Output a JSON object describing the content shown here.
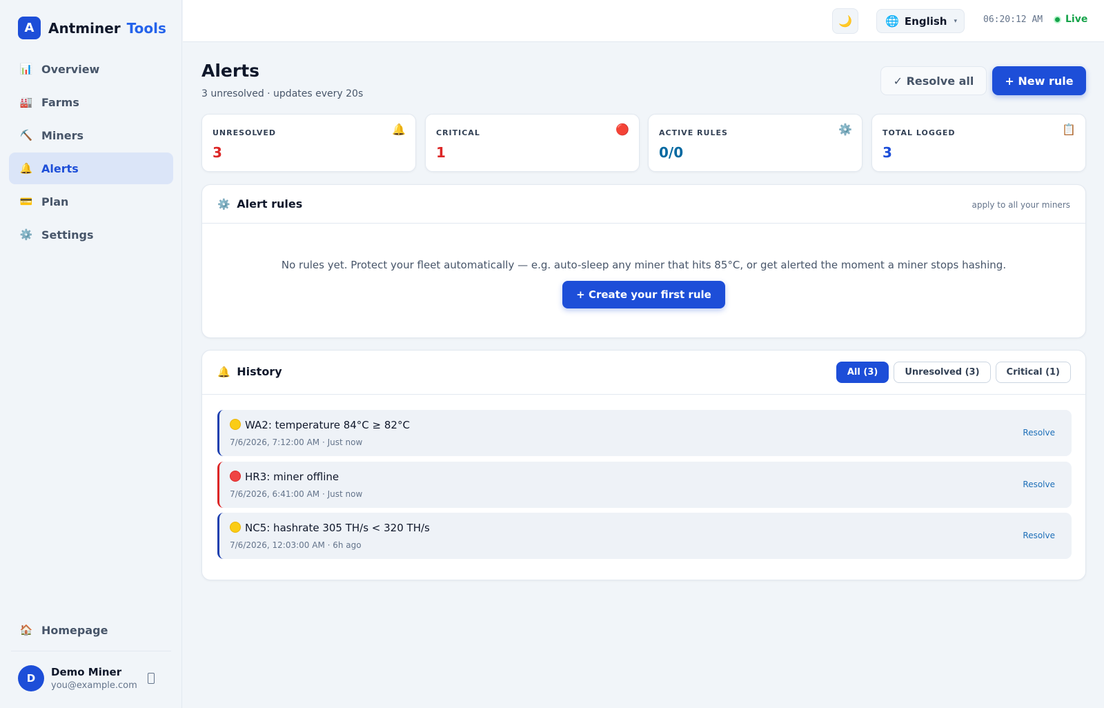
{
  "brand": {
    "badge": "A",
    "name": "Antminer",
    "accent": "Tools"
  },
  "sidebar": {
    "items": [
      {
        "icon": "📊",
        "label": "Overview"
      },
      {
        "icon": "🏭",
        "label": "Farms"
      },
      {
        "icon": "⛏️",
        "label": "Miners"
      },
      {
        "icon": "🔔",
        "label": "Alerts",
        "active": true
      },
      {
        "icon": "💳",
        "label": "Plan"
      },
      {
        "icon": "⚙️",
        "label": "Settings"
      }
    ],
    "homepage": {
      "icon": "🏠",
      "label": "Homepage"
    },
    "user": {
      "initial": "D",
      "name": "Demo Miner",
      "email": "you@example.com"
    }
  },
  "topbar": {
    "theme_icon": "🌙",
    "language": {
      "icon": "🌐",
      "label": "English",
      "caret": "▾"
    },
    "time": "06:20:12 AM",
    "status": "Live"
  },
  "page": {
    "title": "Alerts",
    "subtitle": "3 unresolved · updates every 20s",
    "resolve_all": "✓ Resolve all",
    "new_rule": "+ New rule"
  },
  "stats": [
    {
      "label": "UNRESOLVED",
      "value": "3",
      "icon": "🔔",
      "color": "#dc2626"
    },
    {
      "label": "CRITICAL",
      "value": "1",
      "icon": "🔴",
      "color": "#dc2626"
    },
    {
      "label": "ACTIVE RULES",
      "value": "0/0",
      "icon": "⚙️",
      "color": "#0369a1"
    },
    {
      "label": "TOTAL LOGGED",
      "value": "3",
      "icon": "📋",
      "color": "#1d4ed8"
    }
  ],
  "rules": {
    "icon": "⚙️",
    "title": "Alert rules",
    "note": "apply to all your miners",
    "empty": "No rules yet. Protect your fleet automatically — e.g. auto-sleep any miner that hits 85°C, or get alerted the moment a miner stops hashing.",
    "create": "+ Create your first rule"
  },
  "history": {
    "icon": "🔔",
    "title": "History",
    "filters": [
      "All (3)",
      "Unresolved (3)",
      "Critical (1)"
    ],
    "alerts": [
      {
        "severity": "warning",
        "title": "WA2: temperature 84°C ≥ 82°C",
        "meta": "7/6/2026, 7:12:00 AM · Just now",
        "action": "Resolve"
      },
      {
        "severity": "critical",
        "title": "HR3: miner offline",
        "meta": "7/6/2026, 6:41:00 AM · Just now",
        "action": "Resolve"
      },
      {
        "severity": "warning",
        "title": "NC5: hashrate 305 TH/s < 320 TH/s",
        "meta": "7/6/2026, 12:03:00 AM · 6h ago",
        "action": "Resolve"
      }
    ]
  }
}
